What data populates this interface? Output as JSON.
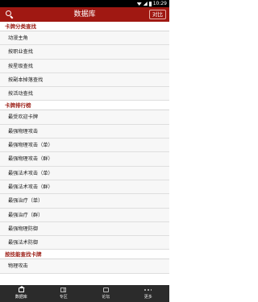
{
  "status_bar": {
    "time": "10:29"
  },
  "app_bar": {
    "title": "数据库",
    "compare_label": "对比"
  },
  "sections": [
    {
      "title": "卡牌分类查找",
      "items": [
        "动漫主角",
        "按职业查找",
        "按星级查找",
        "按副本掉落查找",
        "按活动查找"
      ]
    },
    {
      "title": "卡牌排行榜",
      "items": [
        "最受欢迎卡牌",
        "最强物理攻击",
        "最强物理攻击（单）",
        "最强物理攻击（群）",
        "最强法术攻击（单）",
        "最强法术攻击（群）",
        "最强治疗（单）",
        "最强治疗（群）",
        "最强物理防御",
        "最强法术防御"
      ]
    },
    {
      "title": "按技能查找卡牌",
      "items": [
        "物理攻击"
      ]
    }
  ],
  "tab_bar": {
    "tabs": [
      {
        "label": "数据库",
        "icon": "home-icon"
      },
      {
        "label": "专区",
        "icon": "book-icon"
      },
      {
        "label": "论坛",
        "icon": "chat-icon"
      },
      {
        "label": "更多",
        "icon": "more-icon"
      }
    ]
  },
  "colors": {
    "accent": "#a01812",
    "section_text": "#9b1d15",
    "tab_bar": "#2b2b2b"
  }
}
